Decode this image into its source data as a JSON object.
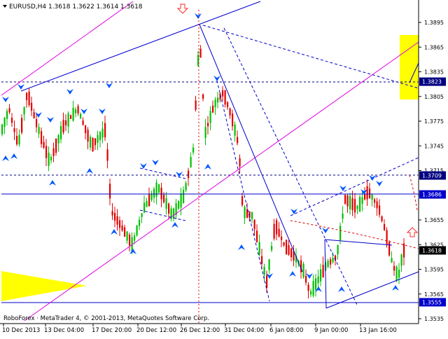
{
  "header": {
    "symbol_info": "EURUSD,H4  1.3618 1.3622 1.3614 1.3618"
  },
  "footer": {
    "copyright": "RoboForex · MetaTrader 4, © 2001-2013, MetaQuotes Software Corp."
  },
  "colors": {
    "background": "#ffffff",
    "bull": "#00c000",
    "bear": "#e00000",
    "trendline_blue": "#0000cc",
    "channel_magenta": "#e000e0",
    "arrow_blue": "#0055ff",
    "target_yellow": "#ffff00",
    "marker_red": "#ff2a2a",
    "price_label_bg": "#000080"
  },
  "icons": {
    "fractal_marker": "blue-chevron-arrow-icon",
    "forecast_arrow": "red-outline-arrow-icon"
  },
  "chart_data": {
    "type": "candlestick",
    "title": "EURUSD,H4",
    "ohlc_last": {
      "open": 1.3618,
      "high": 1.3622,
      "low": 1.3614,
      "close": 1.3618
    },
    "ylim": [
      1.3523,
      1.3913
    ],
    "y_ticks": [
      "1.3895",
      "1.3865",
      "1.3835",
      "1.3805",
      "1.3775",
      "1.3745",
      "1.3715",
      "1.3685",
      "1.3655",
      "1.3625",
      "1.3595",
      "1.3565",
      "1.3535"
    ],
    "x_ticks": [
      "10 Dec 2013",
      "13 Dec 04:00",
      "17 Dec 20:00",
      "20 Dec 12:00",
      "26 Dec 12:00",
      "31 Dec 04:00",
      "6 Jan 08:00",
      "9 Jan 00:00",
      "13 Jan 16:00"
    ],
    "price_labels": [
      {
        "value": 1.3823,
        "text": "1.3823",
        "style": "dotted"
      },
      {
        "value": 1.3709,
        "text": "1.3709",
        "style": "dotted"
      },
      {
        "value": 1.3686,
        "text": "1.3686",
        "style": "solid"
      },
      {
        "value": 1.3618,
        "text": "1.3618",
        "style": "current"
      },
      {
        "value": 1.3555,
        "text": "1.3555",
        "style": "solid"
      }
    ]
  }
}
